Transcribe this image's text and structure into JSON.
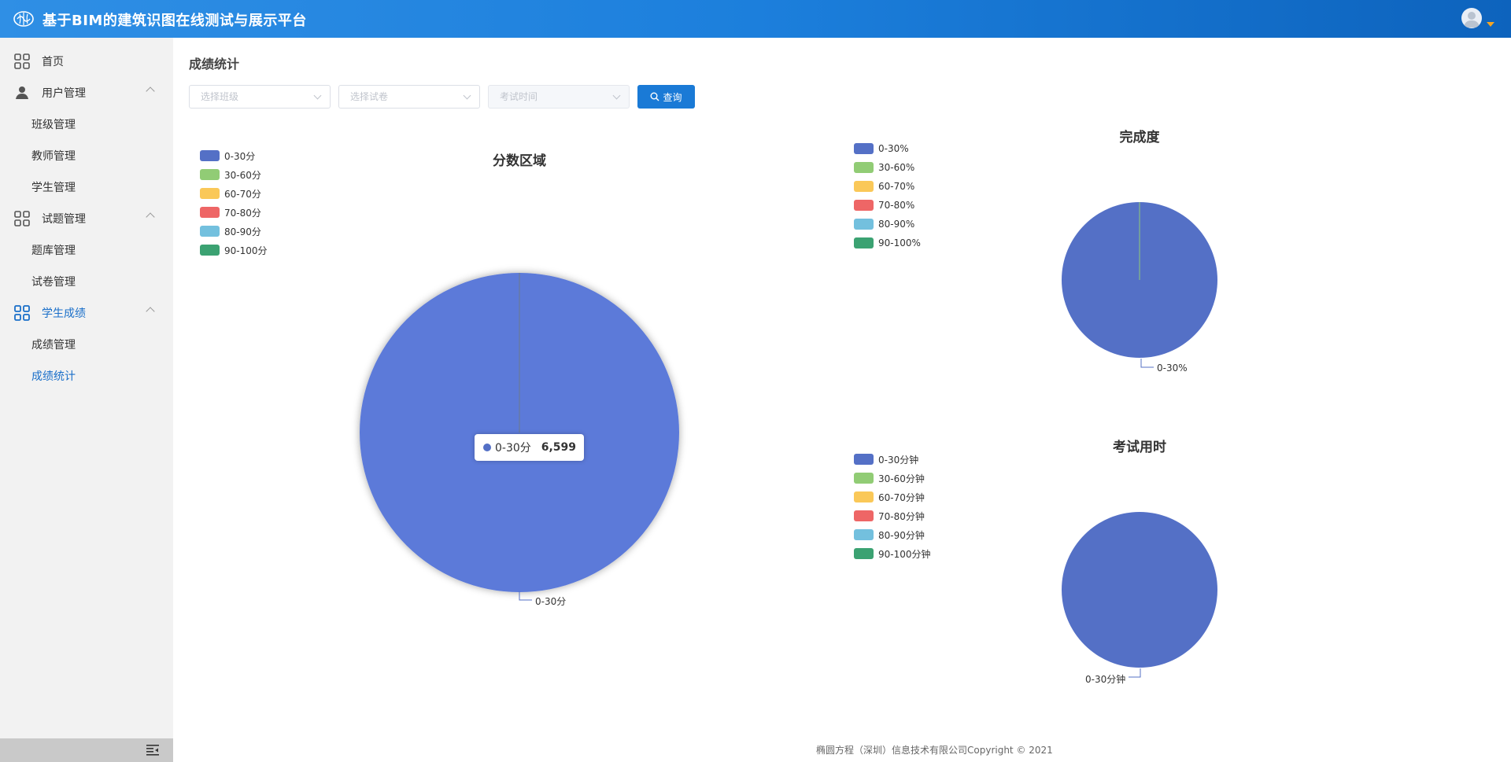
{
  "app": {
    "title": "基于BIM的建筑识图在线测试与展示平台"
  },
  "sidebar": {
    "items": [
      {
        "label": "首页"
      },
      {
        "label": "用户管理"
      },
      {
        "label": "班级管理"
      },
      {
        "label": "教师管理"
      },
      {
        "label": "学生管理"
      },
      {
        "label": "试题管理"
      },
      {
        "label": "题库管理"
      },
      {
        "label": "试卷管理"
      },
      {
        "label": "学生成绩"
      },
      {
        "label": "成绩管理"
      },
      {
        "label": "成绩统计"
      }
    ]
  },
  "main": {
    "title": "成绩统计",
    "filters": {
      "class_placeholder": "选择班级",
      "paper_placeholder": "选择试卷",
      "time_placeholder": "考试时间",
      "query_label": "查询"
    }
  },
  "colors": {
    "header": "#1c7fdc",
    "accent": "#1a7ad6",
    "series": [
      "#5470c6",
      "#91cc75",
      "#fac858",
      "#ee6666",
      "#73c0de",
      "#3ba272"
    ]
  },
  "chart_data": [
    {
      "type": "pie",
      "title": "分数区域",
      "categories": [
        "0-30分",
        "30-60分",
        "60-70分",
        "70-80分",
        "80-90分",
        "90-100分"
      ],
      "values": [
        6599,
        0,
        0,
        0,
        0,
        0
      ],
      "legend": "top-left",
      "slice_label": "0-30分",
      "tooltip": {
        "label": "0-30分",
        "value": "6,599"
      }
    },
    {
      "type": "pie",
      "title": "完成度",
      "categories": [
        "0-30%",
        "30-60%",
        "60-70%",
        "70-80%",
        "80-90%",
        "90-100%"
      ],
      "values": [
        1,
        0,
        0,
        0,
        0,
        0
      ],
      "legend": "top-left",
      "slice_label": "0-30%"
    },
    {
      "type": "pie",
      "title": "考试用时",
      "categories": [
        "0-30分钟",
        "30-60分钟",
        "60-70分钟",
        "70-80分钟",
        "80-90分钟",
        "90-100分钟"
      ],
      "values": [
        1,
        0,
        0,
        0,
        0,
        0
      ],
      "legend": "top-left",
      "slice_label": "0-30分钟"
    }
  ],
  "footer": {
    "copyright": "椭圆方程（深圳）信息技术有限公司Copyright © 2021"
  }
}
